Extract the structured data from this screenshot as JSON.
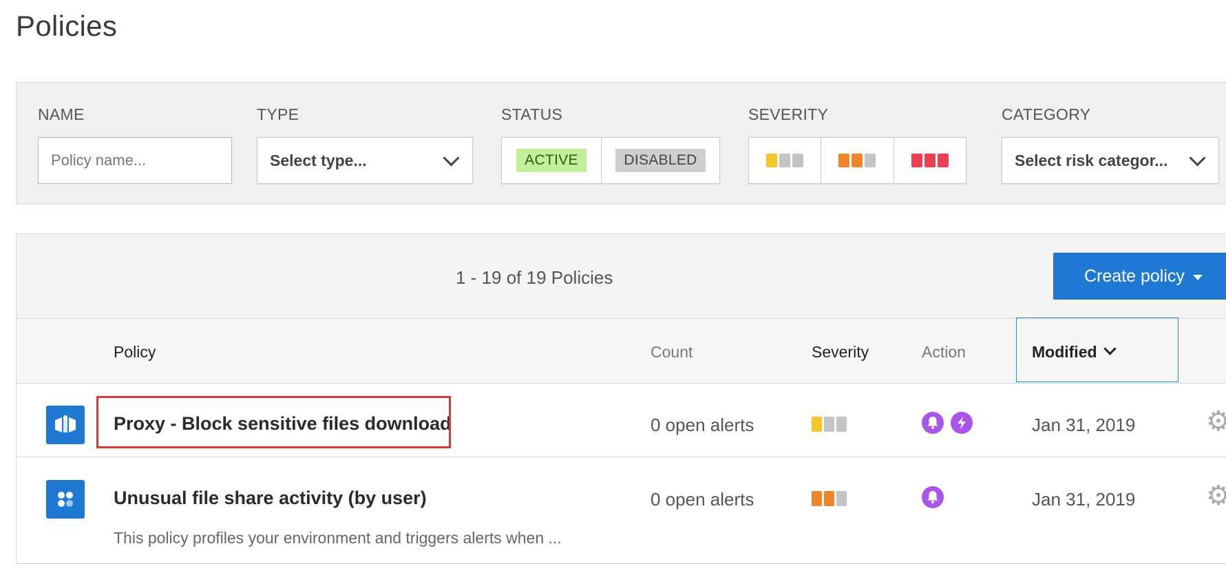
{
  "page": {
    "title": "Policies"
  },
  "filters": {
    "name": {
      "label": "NAME",
      "placeholder": "Policy name..."
    },
    "type": {
      "label": "TYPE",
      "value": "Select type..."
    },
    "status": {
      "label": "STATUS",
      "options": [
        "ACTIVE",
        "DISABLED"
      ]
    },
    "severity": {
      "label": "SEVERITY",
      "levels": [
        "low",
        "medium",
        "high"
      ]
    },
    "category": {
      "label": "CATEGORY",
      "value": "Select risk categor..."
    }
  },
  "table": {
    "count_text": "1 - 19 of 19 Policies",
    "create_button": "Create policy",
    "columns": {
      "policy": "Policy",
      "count": "Count",
      "severity": "Severity",
      "action": "Action",
      "modified": "Modified"
    },
    "rows": [
      {
        "name": "Proxy - Block sensitive files download",
        "count": "0 open alerts",
        "severity": "low",
        "actions": [
          "alert-bell-icon",
          "governance-bolt-icon"
        ],
        "modified": "Jan 31, 2019",
        "icon": "proxy-policy-icon"
      },
      {
        "name": "Unusual file share activity (by user)",
        "count": "0 open alerts",
        "severity": "medium",
        "actions": [
          "alert-bell-icon"
        ],
        "modified": "Jan 31, 2019",
        "icon": "anomaly-policy-icon",
        "description": "This policy profiles your environment and triggers alerts when ..."
      }
    ]
  },
  "colors": {
    "accent": "#1e78d4",
    "active_pill": "#c4ef9b",
    "sev_low": "#f7c52b",
    "sev_medium": "#f0862a",
    "sev_high": "#ee3e52",
    "sev_off": "#c4c4c4",
    "action_purple": "#a855e8",
    "highlight": "#d9383a"
  }
}
